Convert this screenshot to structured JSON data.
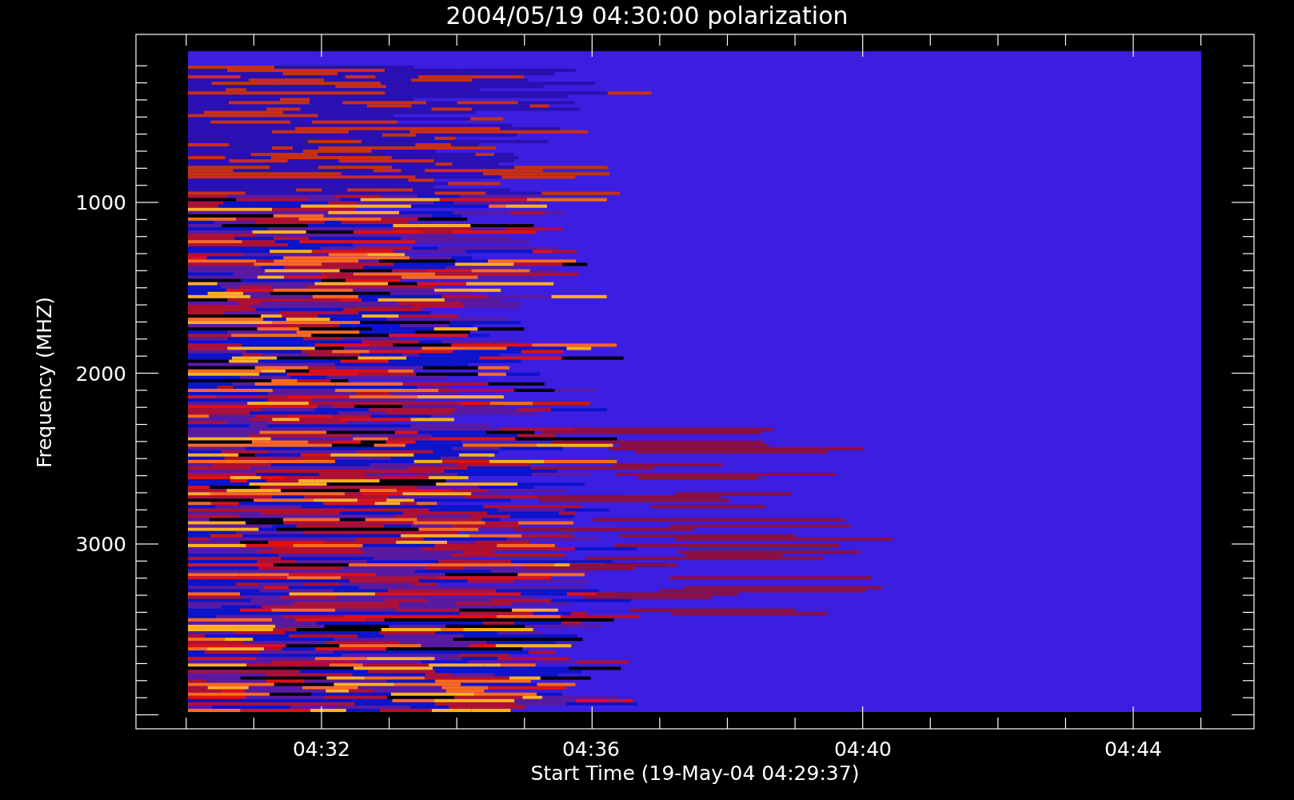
{
  "title": "2004/05/19 04:30:00 polarization",
  "y_axis": {
    "label": "Frequency (MHZ)",
    "ticks": [
      "1000",
      "2000",
      "3000"
    ]
  },
  "x_axis": {
    "label": "Start Time (19-May-04 04:29:37)",
    "ticks": [
      "04:32",
      "04:36",
      "04:40",
      "04:44"
    ]
  }
}
